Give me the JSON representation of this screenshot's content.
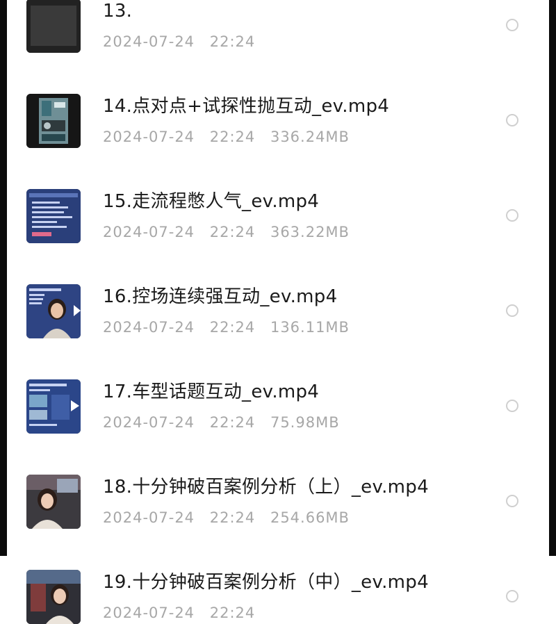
{
  "files": [
    {
      "name": "13.",
      "date": "2024-07-24",
      "time": "22:24",
      "size": "",
      "thumb": "dark-icon",
      "selected": false
    },
    {
      "name": "14.点对点+试探性抛互动_ev.mp4",
      "date": "2024-07-24",
      "time": "22:24",
      "size": "336.24MB",
      "thumb": "video-thumbnail-icon",
      "selected": false
    },
    {
      "name": "15.走流程憋人气_ev.mp4",
      "date": "2024-07-24",
      "time": "22:24",
      "size": "363.22MB",
      "thumb": "slide-thumbnail-icon",
      "selected": false
    },
    {
      "name": "16.控场连续强互动_ev.mp4",
      "date": "2024-07-24",
      "time": "22:24",
      "size": "136.11MB",
      "thumb": "presenter-thumbnail-icon",
      "selected": false
    },
    {
      "name": "17.车型话题互动_ev.mp4",
      "date": "2024-07-24",
      "time": "22:24",
      "size": "75.98MB",
      "thumb": "slide-thumbnail-icon",
      "selected": false
    },
    {
      "name": "18.十分钟破百案例分析（上）_ev.mp4",
      "date": "2024-07-24",
      "time": "22:24",
      "size": "254.66MB",
      "thumb": "presenter-thumbnail-icon",
      "selected": false
    },
    {
      "name": "19.十分钟破百案例分析（中）_ev.mp4",
      "date": "2024-07-24",
      "time": "22:24",
      "size": "",
      "thumb": "presenter-thumbnail-icon",
      "selected": false
    }
  ],
  "colors": {
    "title": "#1a1a1a",
    "meta": "#a7a7a7",
    "radio_border": "#cfcfcf",
    "background": "#ffffff"
  }
}
